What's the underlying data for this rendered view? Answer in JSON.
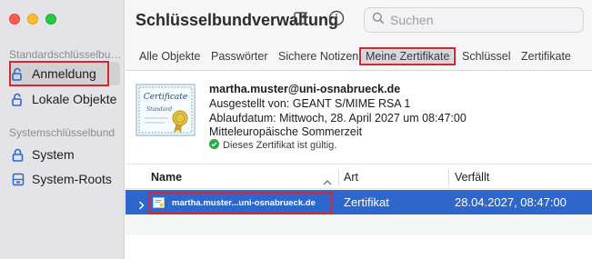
{
  "sidebar": {
    "section1_title": "Standardschlüsselbund",
    "section1_items": [
      {
        "label": "Anmeldung",
        "icon": "unlocked-padlock-icon"
      },
      {
        "label": "Lokale Objekte",
        "icon": "unlocked-padlock-icon"
      }
    ],
    "section2_title": "Systemschlüsselbund",
    "section2_items": [
      {
        "label": "System",
        "icon": "locked-padlock-icon"
      },
      {
        "label": "System-Roots",
        "icon": "cabinet-icon"
      }
    ]
  },
  "toolbar": {
    "title": "Schlüsselbundverwaltung",
    "search_placeholder": "Suchen"
  },
  "tabs": [
    {
      "label": "Alle Objekte"
    },
    {
      "label": "Passwörter"
    },
    {
      "label": "Sichere Notizen"
    },
    {
      "label": "Meine Zertifikate"
    },
    {
      "label": "Schlüssel"
    },
    {
      "label": "Zertifikate"
    }
  ],
  "details": {
    "cert_title_text": "Certificate",
    "cert_subtitle_text": "Standard",
    "name": "martha.muster@uni-osnabrueck.de",
    "issuer": "Ausgestellt von: GEANT S/MIME RSA 1",
    "expiry_line1": "Ablaufdatum: Mittwoch, 28. April 2027 um 08:47:00",
    "expiry_line2": "Mitteleuropäische Sommerzeit",
    "validity": "Dieses Zertifikat ist gültig."
  },
  "table": {
    "columns": [
      "Name",
      "Art",
      "Verfällt"
    ],
    "rows": [
      {
        "name": "martha.muster...uni-osnabrueck.de",
        "kind": "Zertifikat",
        "expires": "28.04.2027, 08:47:00"
      }
    ]
  },
  "colors": {
    "selection": "#2d66cc",
    "highlight_box": "#d6262f",
    "valid_green": "#28a745"
  }
}
